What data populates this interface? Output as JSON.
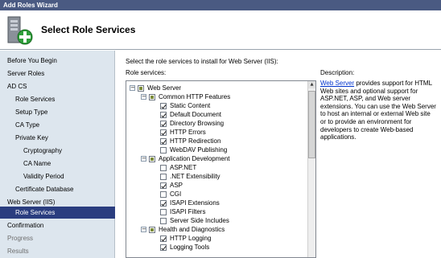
{
  "window": {
    "title": "Add Roles Wizard"
  },
  "header": {
    "title": "Select Role Services"
  },
  "sidebar": {
    "items": [
      {
        "label": "Before You Begin"
      },
      {
        "label": "Server Roles"
      },
      {
        "label": "AD CS"
      },
      {
        "label": "Role Services"
      },
      {
        "label": "Setup Type"
      },
      {
        "label": "CA Type"
      },
      {
        "label": "Private Key"
      },
      {
        "label": "Cryptography"
      },
      {
        "label": "CA Name"
      },
      {
        "label": "Validity Period"
      },
      {
        "label": "Certificate Database"
      },
      {
        "label": "Web Server (IIS)"
      },
      {
        "label": "Role Services"
      },
      {
        "label": "Confirmation"
      },
      {
        "label": "Progress"
      },
      {
        "label": "Results"
      }
    ]
  },
  "main": {
    "instructions": "Select the role services to install for Web Server (IIS):",
    "services_label": "Role services:",
    "description_label": "Description:",
    "description_link": "Web Server",
    "description_text": " provides support for HTML Web sites and optional support for ASP.NET, ASP, and Web server extensions. You can use the Web Server to host an internal or external Web site or to provide an environment for developers to create Web-based applications."
  },
  "tree": [
    {
      "label": "Web Server",
      "state": "partial",
      "expander": "−"
    },
    {
      "label": "Common HTTP Features",
      "state": "partial",
      "expander": "−"
    },
    {
      "label": "Static Content",
      "state": "checked"
    },
    {
      "label": "Default Document",
      "state": "checked"
    },
    {
      "label": "Directory Browsing",
      "state": "checked"
    },
    {
      "label": "HTTP Errors",
      "state": "checked"
    },
    {
      "label": "HTTP Redirection",
      "state": "checked"
    },
    {
      "label": "WebDAV Publishing",
      "state": "unchecked"
    },
    {
      "label": "Application Development",
      "state": "partial",
      "expander": "−"
    },
    {
      "label": "ASP.NET",
      "state": "unchecked"
    },
    {
      "label": ".NET Extensibility",
      "state": "unchecked"
    },
    {
      "label": "ASP",
      "state": "checked"
    },
    {
      "label": "CGI",
      "state": "unchecked"
    },
    {
      "label": "ISAPI Extensions",
      "state": "checked"
    },
    {
      "label": "ISAPI Filters",
      "state": "unchecked"
    },
    {
      "label": "Server Side Includes",
      "state": "unchecked"
    },
    {
      "label": "Health and Diagnostics",
      "state": "partial",
      "expander": "−"
    },
    {
      "label": "HTTP Logging",
      "state": "checked"
    },
    {
      "label": "Logging Tools",
      "state": "checked"
    }
  ],
  "colors": {
    "titlebar": "#4a5a82",
    "sidebar": "#dde6ee",
    "active": "#2a3d7f",
    "link": "#0033cc"
  },
  "icons": {
    "wizard": "server-add-icon",
    "scroll_up": "up-arrow-icon"
  }
}
